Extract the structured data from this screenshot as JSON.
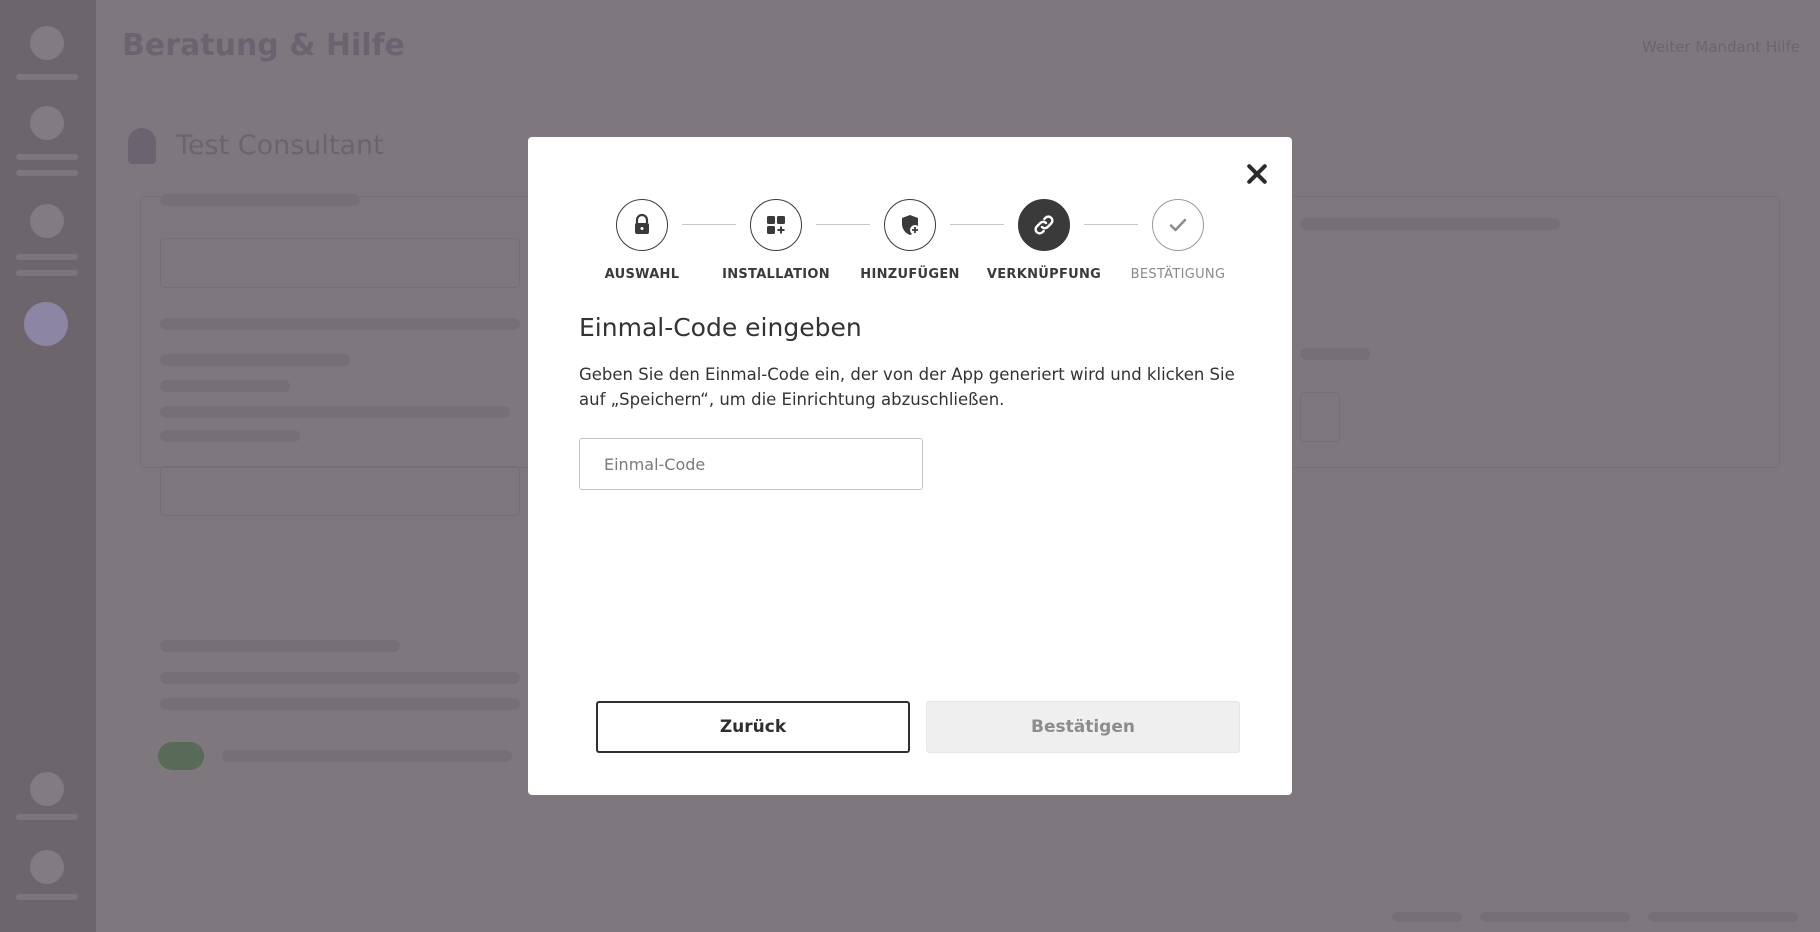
{
  "background": {
    "page_title": "Beratung & Hilfe",
    "top_right": "Weiter Mandant Hilfe",
    "user_name": "Test Consultant"
  },
  "modal": {
    "steps": [
      {
        "label": "AUSWAHL",
        "icon": "lock-icon",
        "state": "done"
      },
      {
        "label": "INSTALLATION",
        "icon": "apps-add-icon",
        "state": "done"
      },
      {
        "label": "HINZUFÜGEN",
        "icon": "shield-add-icon",
        "state": "done"
      },
      {
        "label": "VERKNÜPFUNG",
        "icon": "link-icon",
        "state": "active"
      },
      {
        "label": "BESTÄTIGUNG",
        "icon": "checkmark-icon",
        "state": "pending"
      }
    ],
    "heading": "Einmal-Code eingeben",
    "description": "Geben Sie den Einmal-Code ein, der von der App generiert wird und klicken Sie auf „Speichern“, um die Einrichtung abzuschließen.",
    "input": {
      "placeholder": "Einmal-Code",
      "value": ""
    },
    "back_label": "Zurück",
    "confirm_label": "Bestätigen"
  },
  "colors": {
    "overlay": "#7e787e",
    "active_step": "#3a3a3a",
    "disabled_button": "#efefef"
  }
}
